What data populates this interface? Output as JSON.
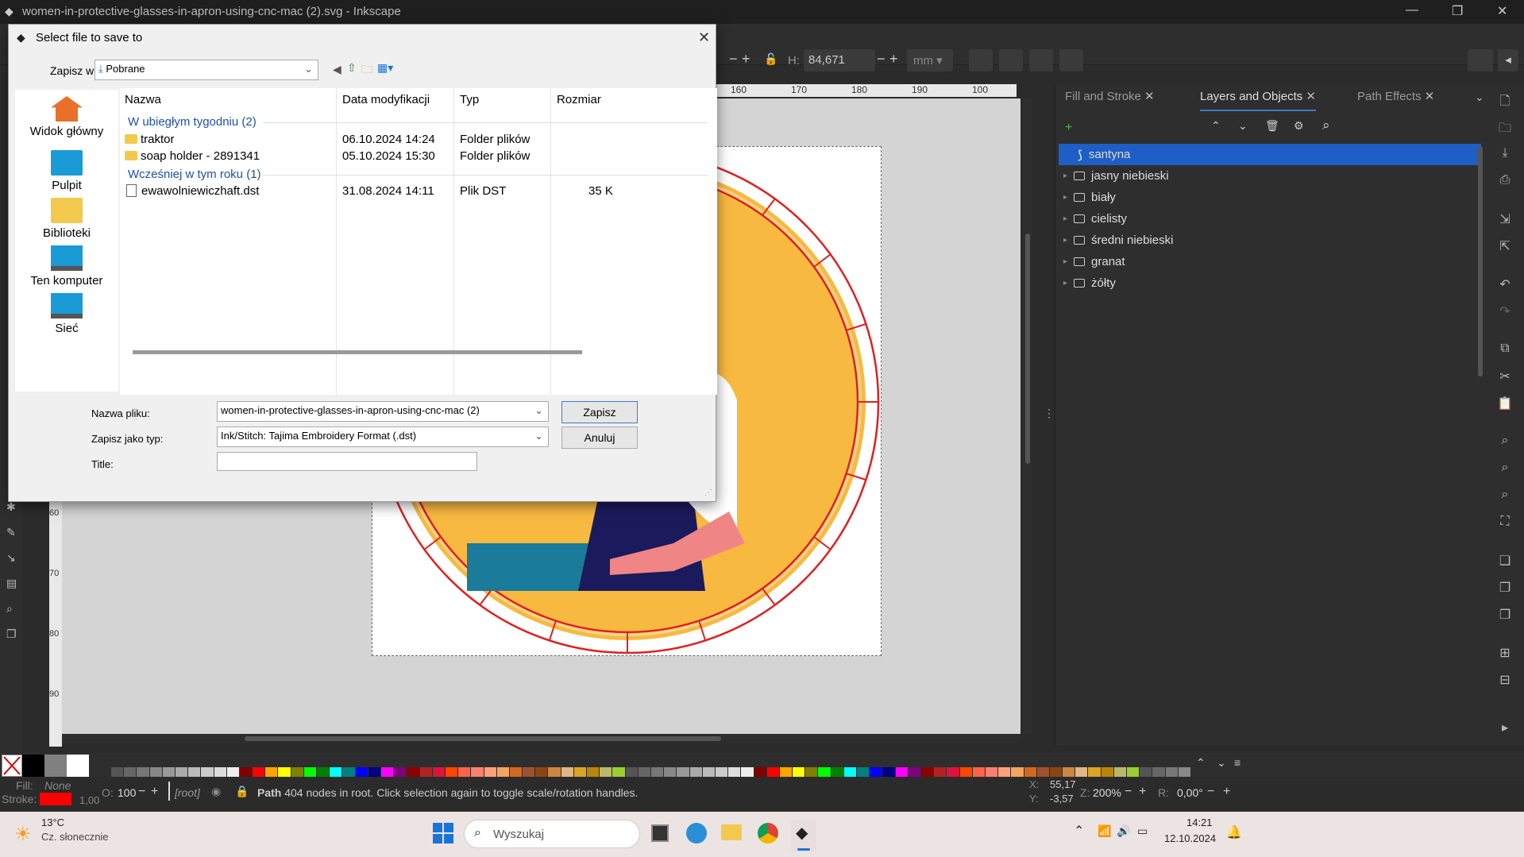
{
  "window": {
    "title": "women-in-protective-glasses-in-apron-using-cnc-mac (2).svg - Inkscape",
    "minimize_glyph": "—",
    "restore_glyph": "❐",
    "close_glyph": "✕"
  },
  "toolbar": {
    "h_label": "H:",
    "h_value": "84,671",
    "units": "mm"
  },
  "ruler": {
    "top_ticks": [
      "160",
      "170",
      "180",
      "190",
      "100"
    ],
    "left_ticks": [
      "60",
      "70",
      "80",
      "90"
    ]
  },
  "panel": {
    "tabs": [
      {
        "label": "Fill and Stroke",
        "active": false
      },
      {
        "label": "Layers and Objects",
        "active": true
      },
      {
        "label": "Path Effects",
        "active": false
      }
    ],
    "layers": [
      {
        "label": "santyna",
        "selected": true,
        "icon": "path-icon"
      },
      {
        "label": "jasny niebieski",
        "selected": false,
        "icon": "folder-icon"
      },
      {
        "label": "biały",
        "selected": false,
        "icon": "folder-icon"
      },
      {
        "label": "cielisty",
        "selected": false,
        "icon": "folder-icon"
      },
      {
        "label": "średni niebieski",
        "selected": false,
        "icon": "folder-icon"
      },
      {
        "label": "granat",
        "selected": false,
        "icon": "folder-icon"
      },
      {
        "label": "żółty",
        "selected": false,
        "icon": "folder-icon"
      }
    ]
  },
  "status": {
    "fill_label": "Fill:",
    "fill_value": "None",
    "stroke_label": "Stroke:",
    "stroke_width": "1,00",
    "stroke_color": "#ff0000",
    "opacity_label": "O:",
    "opacity_value": "100",
    "layer": "[root]",
    "message_bold": "Path",
    "message": " 404 nodes in root. Click selection again to toggle scale/rotation handles.",
    "x_label": "X:",
    "x_value": "55,17",
    "y_label": "Y:",
    "y_value": "-3,57",
    "z_label": "Z:",
    "zoom": "200%",
    "r_label": "R:",
    "rotation": "0,00°"
  },
  "dialog": {
    "title": "Select file to save to",
    "save_in_label": "Zapisz w:",
    "location": "Pobrane",
    "places": [
      "Widok główny",
      "Pulpit",
      "Biblioteki",
      "Ten komputer",
      "Sieć"
    ],
    "columns": [
      "Nazwa",
      "Data modyfikacji",
      "Typ",
      "Rozmiar"
    ],
    "groups": [
      {
        "label": "W ubiegłym tygodniu (2)",
        "files": [
          {
            "name": "traktor",
            "date": "06.10.2024 14:24",
            "type": "Folder plików",
            "size": "",
            "kind": "folder"
          },
          {
            "name": "soap holder - 2891341",
            "date": "05.10.2024 15:30",
            "type": "Folder plików",
            "size": "",
            "kind": "folder"
          }
        ]
      },
      {
        "label": "Wcześniej w tym roku (1)",
        "files": [
          {
            "name": "ewawolniewiczhaft.dst",
            "date": "31.08.2024 14:11",
            "type": "Plik DST",
            "size": "35 K",
            "kind": "file"
          }
        ]
      }
    ],
    "filename_label": "Nazwa pliku:",
    "filename_value": "women-in-protective-glasses-in-apron-using-cnc-mac (2)",
    "filetype_label": "Zapisz jako typ:",
    "filetype_value": "Ink/Stitch: Tajima Embroidery Format (.dst)",
    "title_label": "Title:",
    "title_value": "",
    "save_button": "Zapisz",
    "cancel_button": "Anuluj"
  },
  "taskbar": {
    "weather_temp": "13°C",
    "weather_desc": "Cz. słonecznie",
    "search_label": "Wyszukaj",
    "time": "14:21",
    "date": "12.10.2024"
  },
  "colors": {
    "accent": "#1f5ec4",
    "artwork_yellow": "#f8b940",
    "artwork_navy": "#1b1a5c",
    "artwork_teal": "#1a7b9a",
    "artwork_skin": "#f08585",
    "guide_red": "#e02020"
  }
}
